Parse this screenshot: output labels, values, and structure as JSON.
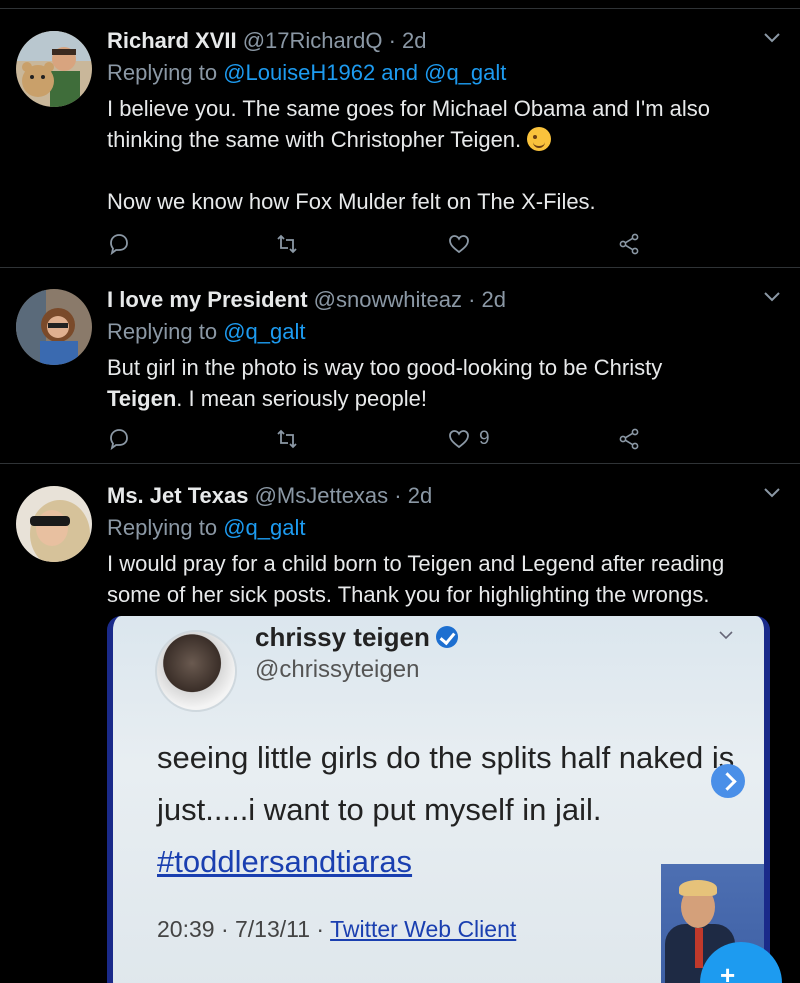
{
  "tweets": [
    {
      "name": "Richard XVII",
      "handle": "@17RichardQ",
      "dot": "·",
      "time": "2d",
      "replying_prefix": "Replying to ",
      "replying_to": "@LouiseH1962 and @q_galt",
      "text_line1": "I believe you.  The same goes for Michael Obama and I'm also",
      "text_line2": "thinking the same with Christopher Teigen. ",
      "text_line3": "Now we know how Fox Mulder felt on The X-Files.",
      "like_count": "",
      "emoji": "winking-face"
    },
    {
      "name": "I love my President",
      "handle": "@snowwhiteaz",
      "dot": "·",
      "time": "2d",
      "replying_prefix": "Replying to ",
      "replying_to": "@q_galt",
      "text_part1": "But girl in the photo is way too good-looking to be Christy",
      "text_bold": "Teigen",
      "text_part2": ". I mean seriously people!",
      "like_count": "9"
    },
    {
      "name": "Ms. Jet Texas",
      "handle": "@MsJettexas",
      "dot": "·",
      "time": "2d",
      "replying_prefix": "Replying to ",
      "replying_to": "@q_galt",
      "text": "I would pray for a child born to Teigen and Legend after reading some of her sick posts. Thank you for highlighting the wrongs.",
      "media": {
        "name": "chrissy teigen",
        "handle": "@chrissyteigen",
        "text_main": "seeing little girls do the splits half naked is just.....i want to put myself in jail. ",
        "hashtag": "#toddlersandtiaras",
        "meta_time": "20:39 · 7/13/11 · ",
        "meta_client": "Twitter Web Client"
      }
    }
  ],
  "fab": {
    "label": "+"
  },
  "colors": {
    "background": "#000000",
    "text": "#e7e9ea",
    "muted": "#8b98a5",
    "link": "#1d9bf0",
    "divider": "#2f3336"
  }
}
